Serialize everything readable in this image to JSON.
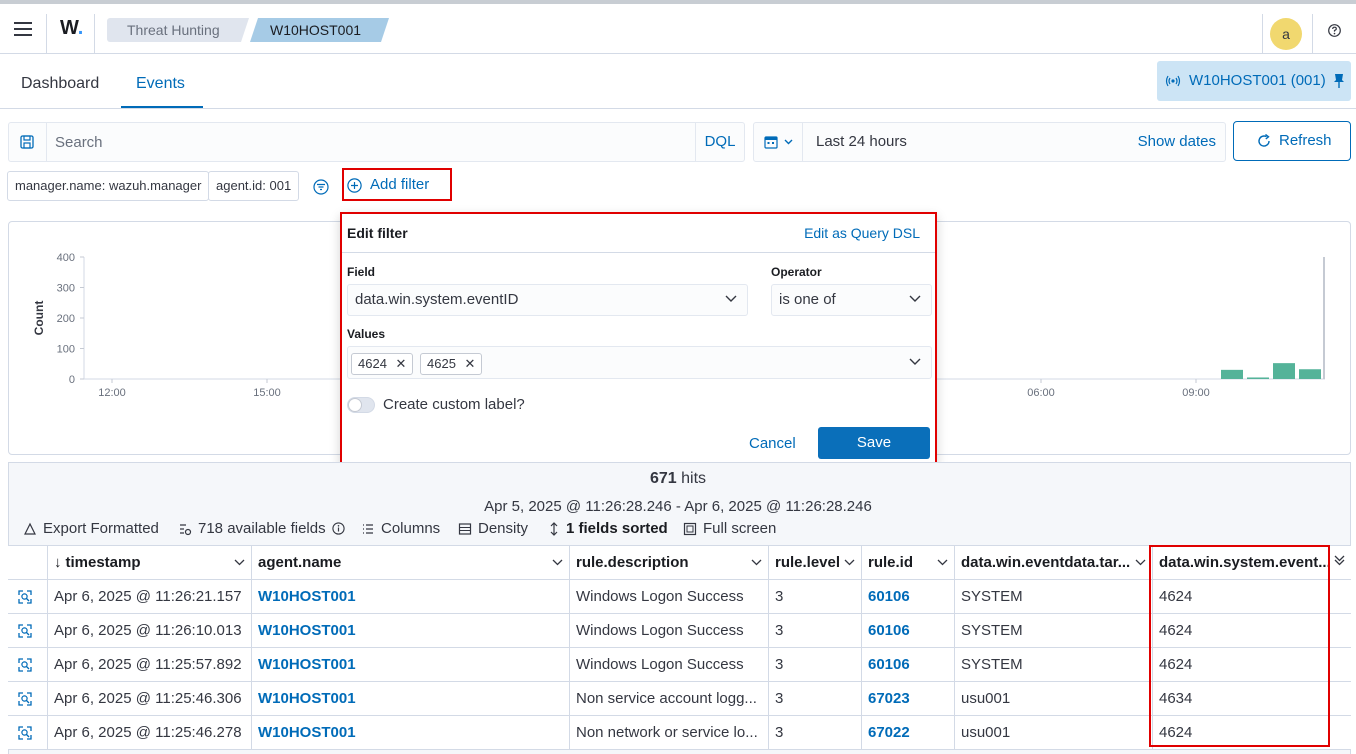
{
  "header": {
    "logo": "W.",
    "breadcrumbs": [
      "Threat Hunting",
      "W10HOST001"
    ],
    "avatar_initial": "a"
  },
  "tabs": {
    "items": [
      {
        "label": "Dashboard"
      },
      {
        "label": "Events"
      }
    ],
    "active": "Events",
    "agent_button_label": "W10HOST001 (001)"
  },
  "search": {
    "placeholder": "Search",
    "language": "DQL",
    "date_range": "Last 24 hours",
    "show_dates_label": "Show dates",
    "refresh_label": "Refresh"
  },
  "filters": {
    "pills": [
      "manager.name: wazuh.manager",
      "agent.id: 001"
    ],
    "add_filter_label": "Add filter"
  },
  "popover": {
    "title": "Edit filter",
    "edit_dsl_label": "Edit as Query DSL",
    "field_label": "Field",
    "field_value": "data.win.system.eventID",
    "operator_label": "Operator",
    "operator_value": "is one of",
    "values_label": "Values",
    "values": [
      "4624",
      "4625"
    ],
    "custom_label_text": "Create custom label?",
    "custom_label_enabled": false,
    "cancel_label": "Cancel",
    "save_label": "Save"
  },
  "chart_data": {
    "type": "bar",
    "ylabel": "Count",
    "yticks": [
      0,
      100,
      200,
      300,
      400
    ],
    "ylim": [
      0,
      400
    ],
    "xtick_labels": [
      "12:00",
      "15:00",
      "06:00",
      "09:00"
    ],
    "visible_bars": [
      {
        "label": "bin-1",
        "value": 30
      },
      {
        "label": "bin-2",
        "value": 5
      },
      {
        "label": "bin-3",
        "value": 52
      },
      {
        "label": "bin-4",
        "value": 32
      }
    ],
    "bar_color": "#54b399"
  },
  "results": {
    "hits_count": "671",
    "hits_label": "hits",
    "time_range": "Apr 5, 2025 @ 11:26:28.246 - Apr 6, 2025 @ 11:26:28.246",
    "toolbar": {
      "export": "Export Formatted",
      "fields": "718 available fields",
      "columns": "Columns",
      "density": "Density",
      "sorted": "1 fields sorted",
      "fullscreen": "Full screen"
    },
    "columns": [
      "timestamp",
      "agent.name",
      "rule.description",
      "rule.level",
      "rule.id",
      "data.win.eventdata.tar...",
      "data.win.system.event..."
    ],
    "rows": [
      {
        "timestamp": "Apr 6, 2025 @ 11:26:21.157",
        "agent": "W10HOST001",
        "description": "Windows Logon Success",
        "level": "3",
        "rule_id": "60106",
        "target": "SYSTEM",
        "event_id": "4624"
      },
      {
        "timestamp": "Apr 6, 2025 @ 11:26:10.013",
        "agent": "W10HOST001",
        "description": "Windows Logon Success",
        "level": "3",
        "rule_id": "60106",
        "target": "SYSTEM",
        "event_id": "4624"
      },
      {
        "timestamp": "Apr 6, 2025 @ 11:25:57.892",
        "agent": "W10HOST001",
        "description": "Windows Logon Success",
        "level": "3",
        "rule_id": "60106",
        "target": "SYSTEM",
        "event_id": "4624"
      },
      {
        "timestamp": "Apr 6, 2025 @ 11:25:46.306",
        "agent": "W10HOST001",
        "description": "Non service account logg...",
        "level": "3",
        "rule_id": "67023",
        "target": "usu001",
        "event_id": "4634"
      },
      {
        "timestamp": "Apr 6, 2025 @ 11:25:46.278",
        "agent": "W10HOST001",
        "description": "Non network or service lo...",
        "level": "3",
        "rule_id": "67022",
        "target": "usu001",
        "event_id": "4624"
      }
    ]
  }
}
